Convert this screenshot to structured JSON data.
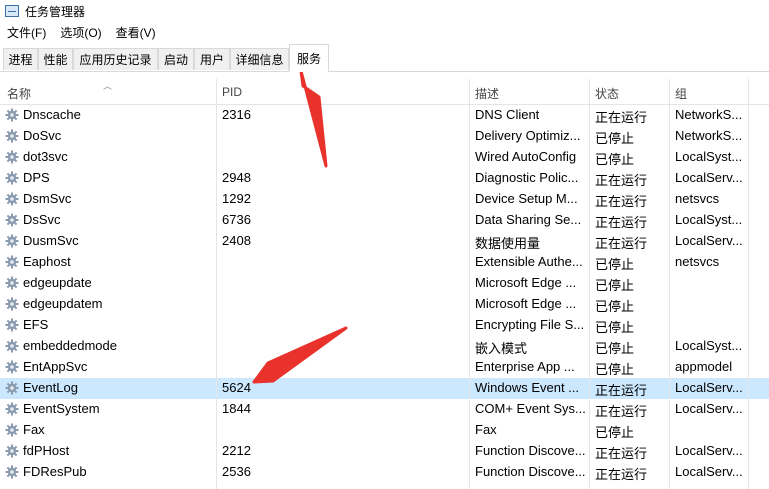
{
  "window": {
    "title": "任务管理器",
    "icon": "task-manager-icon"
  },
  "menu": [
    "文件(F)",
    "选项(O)",
    "查看(V)"
  ],
  "tabs": [
    "进程",
    "性能",
    "应用历史记录",
    "启动",
    "用户",
    "详细信息",
    "服务"
  ],
  "active_tab": "服务",
  "columns": [
    "名称",
    "PID",
    "描述",
    "状态",
    "组"
  ],
  "selected_row": "EventLog",
  "row_icon": "gear-service-icon",
  "rows": [
    {
      "name": "Dnscache",
      "pid": "2316",
      "desc": "DNS Client",
      "status": "正在运行",
      "group": "NetworkS..."
    },
    {
      "name": "DoSvc",
      "pid": "",
      "desc": "Delivery Optimiz...",
      "status": "已停止",
      "group": "NetworkS..."
    },
    {
      "name": "dot3svc",
      "pid": "",
      "desc": "Wired AutoConfig",
      "status": "已停止",
      "group": "LocalSyst..."
    },
    {
      "name": "DPS",
      "pid": "2948",
      "desc": "Diagnostic Polic...",
      "status": "正在运行",
      "group": "LocalServ..."
    },
    {
      "name": "DsmSvc",
      "pid": "1292",
      "desc": "Device Setup M...",
      "status": "正在运行",
      "group": "netsvcs"
    },
    {
      "name": "DsSvc",
      "pid": "6736",
      "desc": "Data Sharing Se...",
      "status": "正在运行",
      "group": "LocalSyst..."
    },
    {
      "name": "DusmSvc",
      "pid": "2408",
      "desc": "数据使用量",
      "status": "正在运行",
      "group": "LocalServ..."
    },
    {
      "name": "Eaphost",
      "pid": "",
      "desc": "Extensible Authe...",
      "status": "已停止",
      "group": "netsvcs"
    },
    {
      "name": "edgeupdate",
      "pid": "",
      "desc": "Microsoft Edge ...",
      "status": "已停止",
      "group": ""
    },
    {
      "name": "edgeupdatem",
      "pid": "",
      "desc": "Microsoft Edge ...",
      "status": "已停止",
      "group": ""
    },
    {
      "name": "EFS",
      "pid": "",
      "desc": "Encrypting File S...",
      "status": "已停止",
      "group": ""
    },
    {
      "name": "embeddedmode",
      "pid": "",
      "desc": "嵌入模式",
      "status": "已停止",
      "group": "LocalSyst..."
    },
    {
      "name": "EntAppSvc",
      "pid": "",
      "desc": "Enterprise App ...",
      "status": "已停止",
      "group": "appmodel"
    },
    {
      "name": "EventLog",
      "pid": "5624",
      "desc": "Windows Event ...",
      "status": "正在运行",
      "group": "LocalServ..."
    },
    {
      "name": "EventSystem",
      "pid": "1844",
      "desc": "COM+ Event Sys...",
      "status": "正在运行",
      "group": "LocalServ..."
    },
    {
      "name": "Fax",
      "pid": "",
      "desc": "Fax",
      "status": "已停止",
      "group": ""
    },
    {
      "name": "fdPHost",
      "pid": "2212",
      "desc": "Function Discove...",
      "status": "正在运行",
      "group": "LocalServ..."
    },
    {
      "name": "FDResPub",
      "pid": "2536",
      "desc": "Function Discove...",
      "status": "正在运行",
      "group": "LocalServ..."
    }
  ],
  "colors": {
    "selected_row": "#cce8ff",
    "annotation_arrow": "#e8322b"
  }
}
